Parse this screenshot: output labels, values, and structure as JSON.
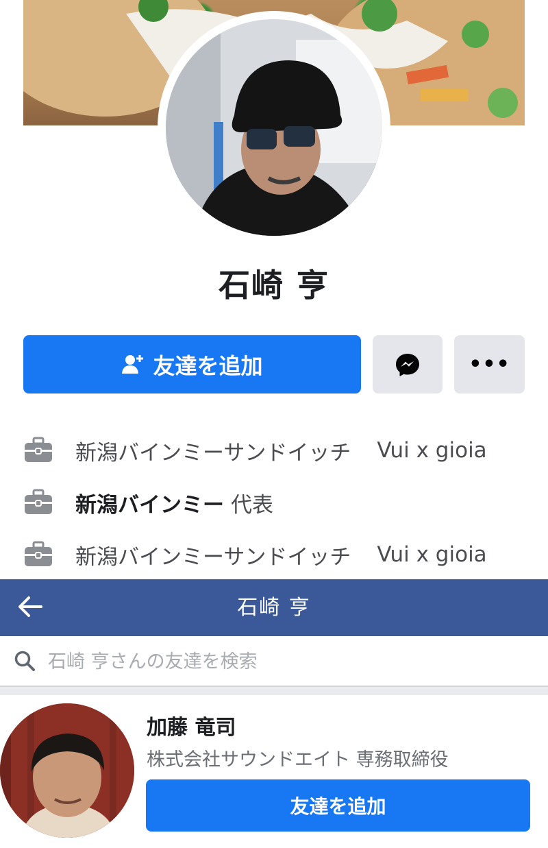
{
  "profile": {
    "name": "石崎 亨",
    "add_friend_label": "友達を追加",
    "more_label": "•••"
  },
  "work": [
    {
      "text": "新潟バインミーサンドイッチ",
      "text2": "Vui x gioia"
    },
    {
      "strong": "新潟バインミー",
      "text": "代表"
    },
    {
      "text": "新潟バインミーサンドイッチ",
      "text2": "Vui x gioia"
    }
  ],
  "friends_header": {
    "title": "石崎 亨"
  },
  "search": {
    "placeholder": "石崎 亨さんの友達を検索"
  },
  "friend": {
    "name": "加藤 竜司",
    "subtitle": "株式会社サウンドエイト 専務取締役",
    "add_friend_label": "友達を追加"
  },
  "colors": {
    "primary": "#1877f2",
    "header": "#3b5998",
    "button_gray": "#e4e6eb"
  }
}
